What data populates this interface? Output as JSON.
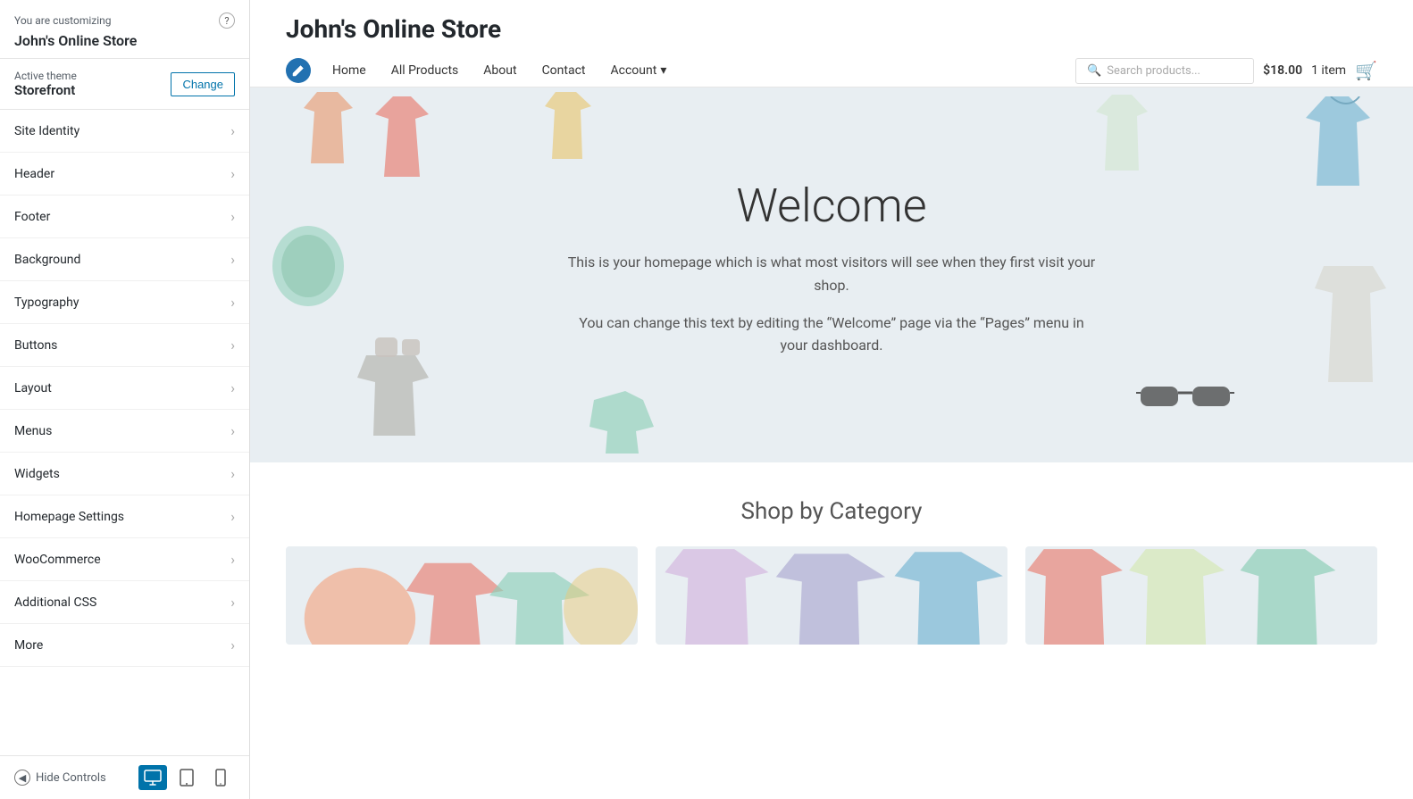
{
  "panel": {
    "customizing_label": "You are customizing",
    "store_name": "John's Online Store",
    "help_icon": "?",
    "active_theme_label": "Active theme",
    "theme_name": "Storefront",
    "change_button": "Change",
    "menu_items": [
      {
        "label": "Site Identity",
        "id": "site-identity"
      },
      {
        "label": "Header",
        "id": "header"
      },
      {
        "label": "Footer",
        "id": "footer"
      },
      {
        "label": "Background",
        "id": "background"
      },
      {
        "label": "Typography",
        "id": "typography"
      },
      {
        "label": "Buttons",
        "id": "buttons"
      },
      {
        "label": "Layout",
        "id": "layout"
      },
      {
        "label": "Menus",
        "id": "menus"
      },
      {
        "label": "Widgets",
        "id": "widgets"
      },
      {
        "label": "Homepage Settings",
        "id": "homepage-settings"
      },
      {
        "label": "WooCommerce",
        "id": "woocommerce"
      },
      {
        "label": "Additional CSS",
        "id": "additional-css"
      },
      {
        "label": "More",
        "id": "more"
      }
    ],
    "hide_controls_label": "Hide Controls",
    "view_desktop": "desktop",
    "view_tablet": "tablet",
    "view_mobile": "mobile"
  },
  "preview": {
    "store_title": "John's Online Store",
    "nav_links": [
      {
        "label": "Home",
        "id": "home"
      },
      {
        "label": "All Products",
        "id": "all-products"
      },
      {
        "label": "About",
        "id": "about"
      },
      {
        "label": "Contact",
        "id": "contact"
      },
      {
        "label": "Account",
        "id": "account",
        "has_dropdown": true
      }
    ],
    "cart_amount": "$18.00",
    "cart_items": "1 item",
    "search_placeholder": "Search products...",
    "hero_title": "Welcome",
    "hero_text1": "This is your homepage which is what most visitors will see when they first visit your shop.",
    "hero_text2": "You can change this text by editing the “Welcome” page via the “Pages” menu in your dashboard.",
    "shop_section_title": "Shop by Category"
  }
}
